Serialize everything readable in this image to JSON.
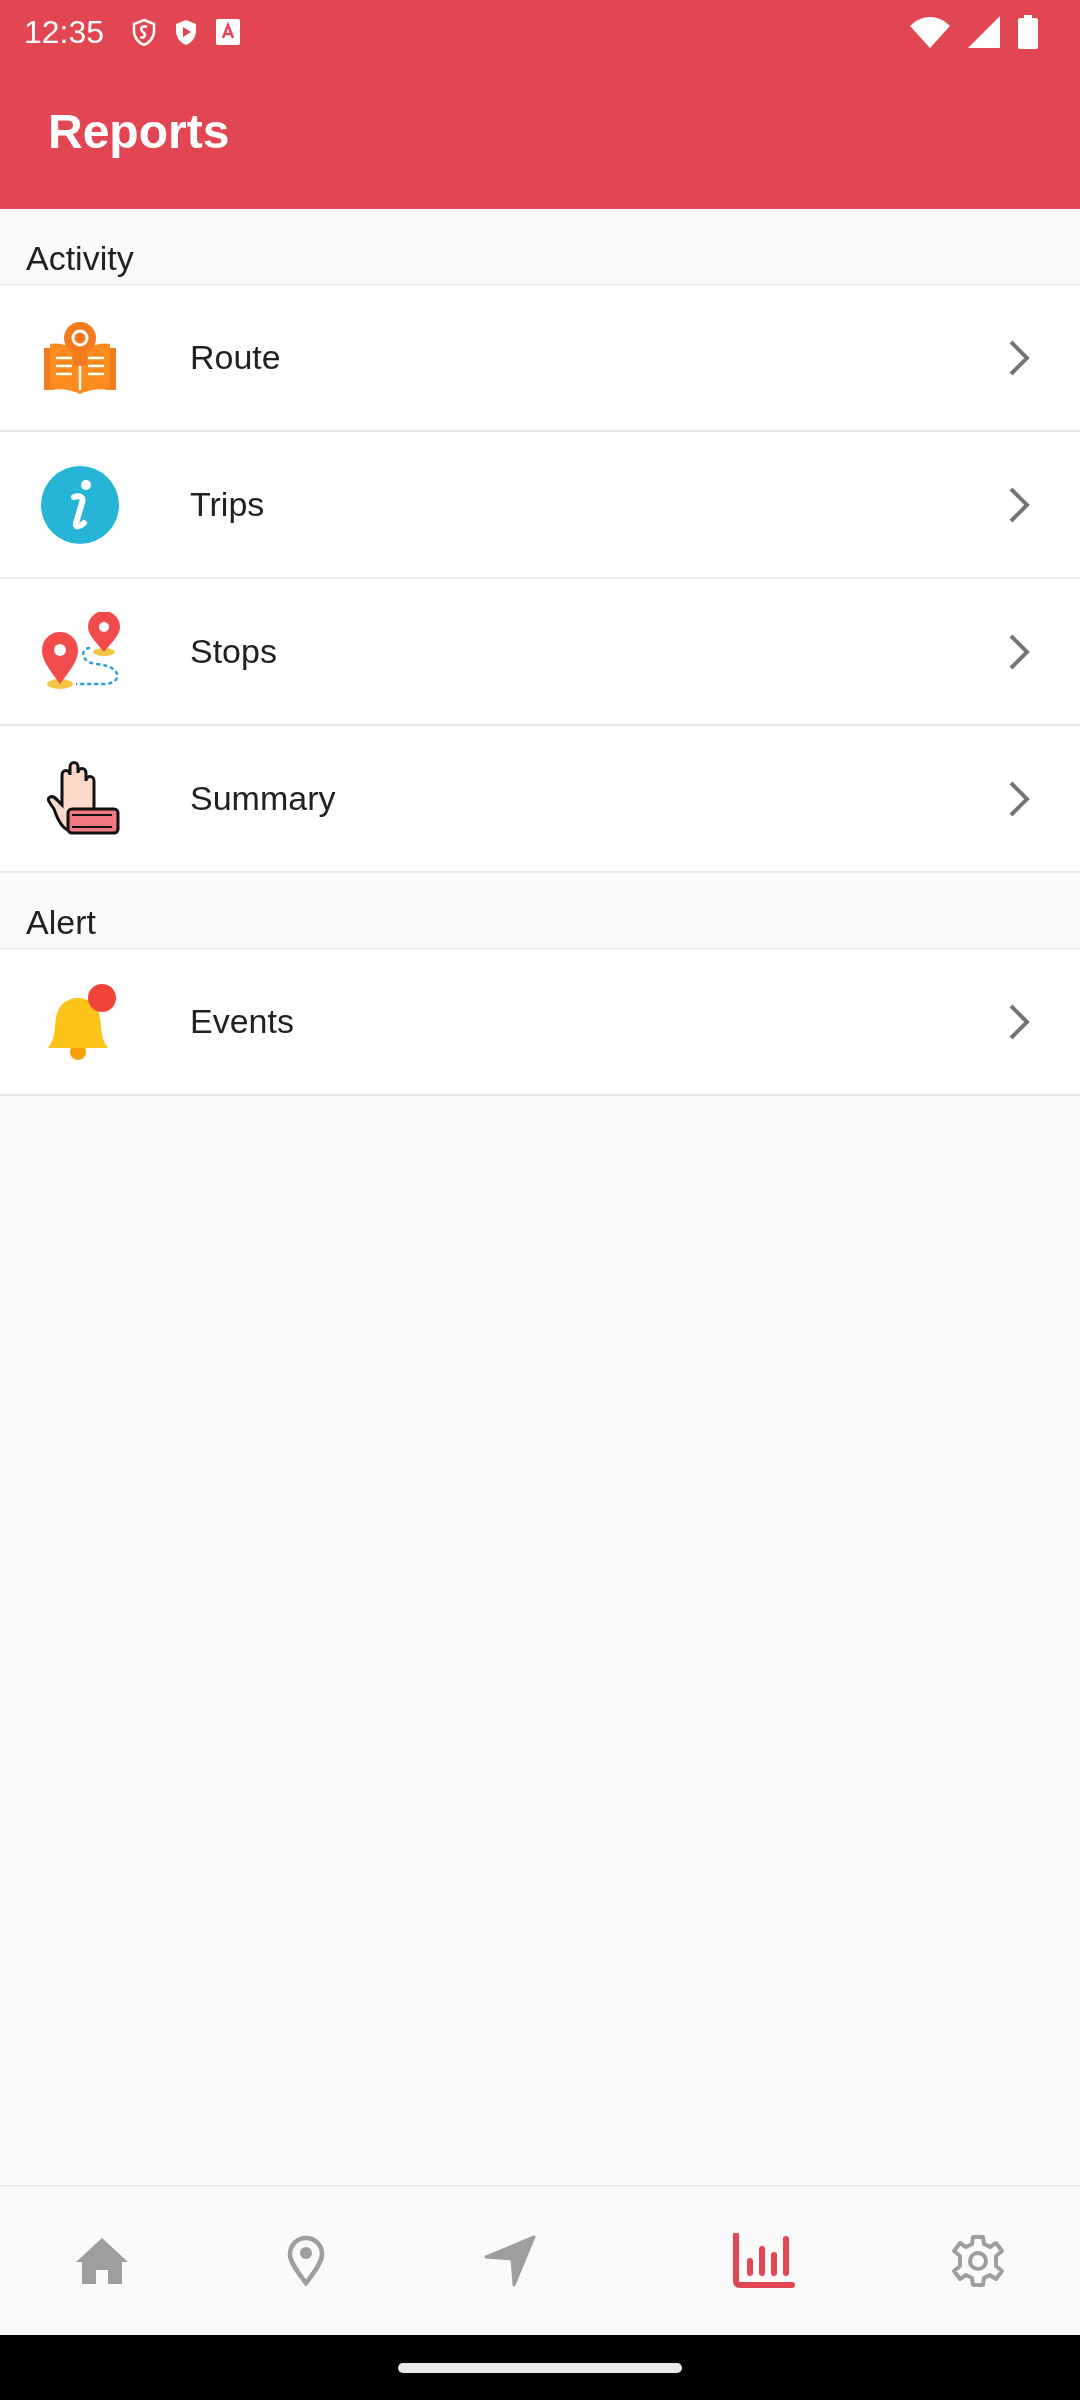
{
  "status_bar": {
    "time": "12:35"
  },
  "app_bar": {
    "title": "Reports"
  },
  "sections": [
    {
      "title": "Activity",
      "items": [
        {
          "label": "Route",
          "kind": "route"
        },
        {
          "label": "Trips",
          "kind": "info"
        },
        {
          "label": "Stops",
          "kind": "stops"
        },
        {
          "label": "Summary",
          "kind": "stop"
        }
      ]
    },
    {
      "title": "Alert",
      "items": [
        {
          "label": "Events",
          "kind": "bell"
        }
      ]
    }
  ],
  "bottom_nav": [
    {
      "kind": "home",
      "selected": false
    },
    {
      "kind": "pin",
      "selected": false
    },
    {
      "kind": "navigate",
      "selected": false
    },
    {
      "kind": "chart",
      "selected": true
    },
    {
      "kind": "settings",
      "selected": false
    }
  ]
}
